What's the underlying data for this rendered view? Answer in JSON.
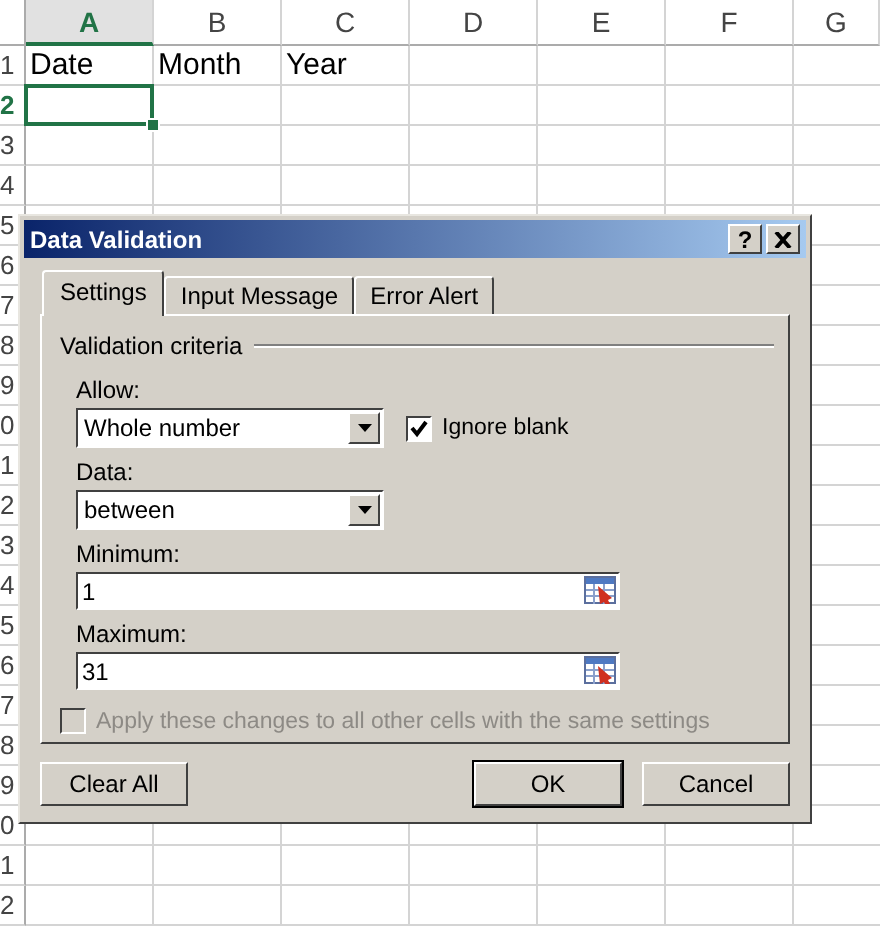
{
  "sheet": {
    "columns": [
      {
        "label": "A",
        "selected": true
      },
      {
        "label": "B",
        "selected": false
      },
      {
        "label": "C",
        "selected": false
      },
      {
        "label": "D",
        "selected": false
      },
      {
        "label": "E",
        "selected": false
      },
      {
        "label": "F",
        "selected": false
      },
      {
        "label": "G",
        "selected": false
      }
    ],
    "rows": [
      {
        "label": "1",
        "selected": false,
        "cells": [
          "Date",
          "Month",
          "Year"
        ]
      },
      {
        "label": "2",
        "selected": true
      },
      {
        "label": "3",
        "selected": false
      },
      {
        "label": "4",
        "selected": false
      },
      {
        "label": "5",
        "selected": false
      },
      {
        "label": "6",
        "selected": false
      },
      {
        "label": "7",
        "selected": false
      },
      {
        "label": "8",
        "selected": false
      },
      {
        "label": "9",
        "selected": false
      },
      {
        "label": "0",
        "selected": false
      },
      {
        "label": "1",
        "selected": false
      },
      {
        "label": "2",
        "selected": false
      },
      {
        "label": "3",
        "selected": false
      },
      {
        "label": "4",
        "selected": false
      },
      {
        "label": "5",
        "selected": false
      },
      {
        "label": "6",
        "selected": false
      },
      {
        "label": "7",
        "selected": false
      },
      {
        "label": "8",
        "selected": false
      },
      {
        "label": "9",
        "selected": false
      },
      {
        "label": "0",
        "selected": false
      },
      {
        "label": "1",
        "selected": false
      },
      {
        "label": "2",
        "selected": false
      }
    ]
  },
  "dialog": {
    "title": "Data Validation",
    "help": "?",
    "tabs": [
      {
        "label": "Settings",
        "selected": true
      },
      {
        "label": "Input Message",
        "selected": false
      },
      {
        "label": "Error Alert",
        "selected": false
      }
    ],
    "group_title": "Validation criteria",
    "allow": {
      "label": "Allow:",
      "value": "Whole number"
    },
    "ignore_blank": {
      "label": "Ignore blank",
      "checked": true
    },
    "data": {
      "label": "Data:",
      "value": "between"
    },
    "minimum": {
      "label": "Minimum:",
      "value": "1"
    },
    "maximum": {
      "label": "Maximum:",
      "value": "31"
    },
    "apply_all": {
      "label": "Apply these changes to all other cells with the same settings",
      "checked": false,
      "disabled": true
    },
    "buttons": [
      {
        "label": "Clear All",
        "default": false
      },
      {
        "label": "OK",
        "default": true
      },
      {
        "label": "Cancel",
        "default": false
      }
    ]
  }
}
